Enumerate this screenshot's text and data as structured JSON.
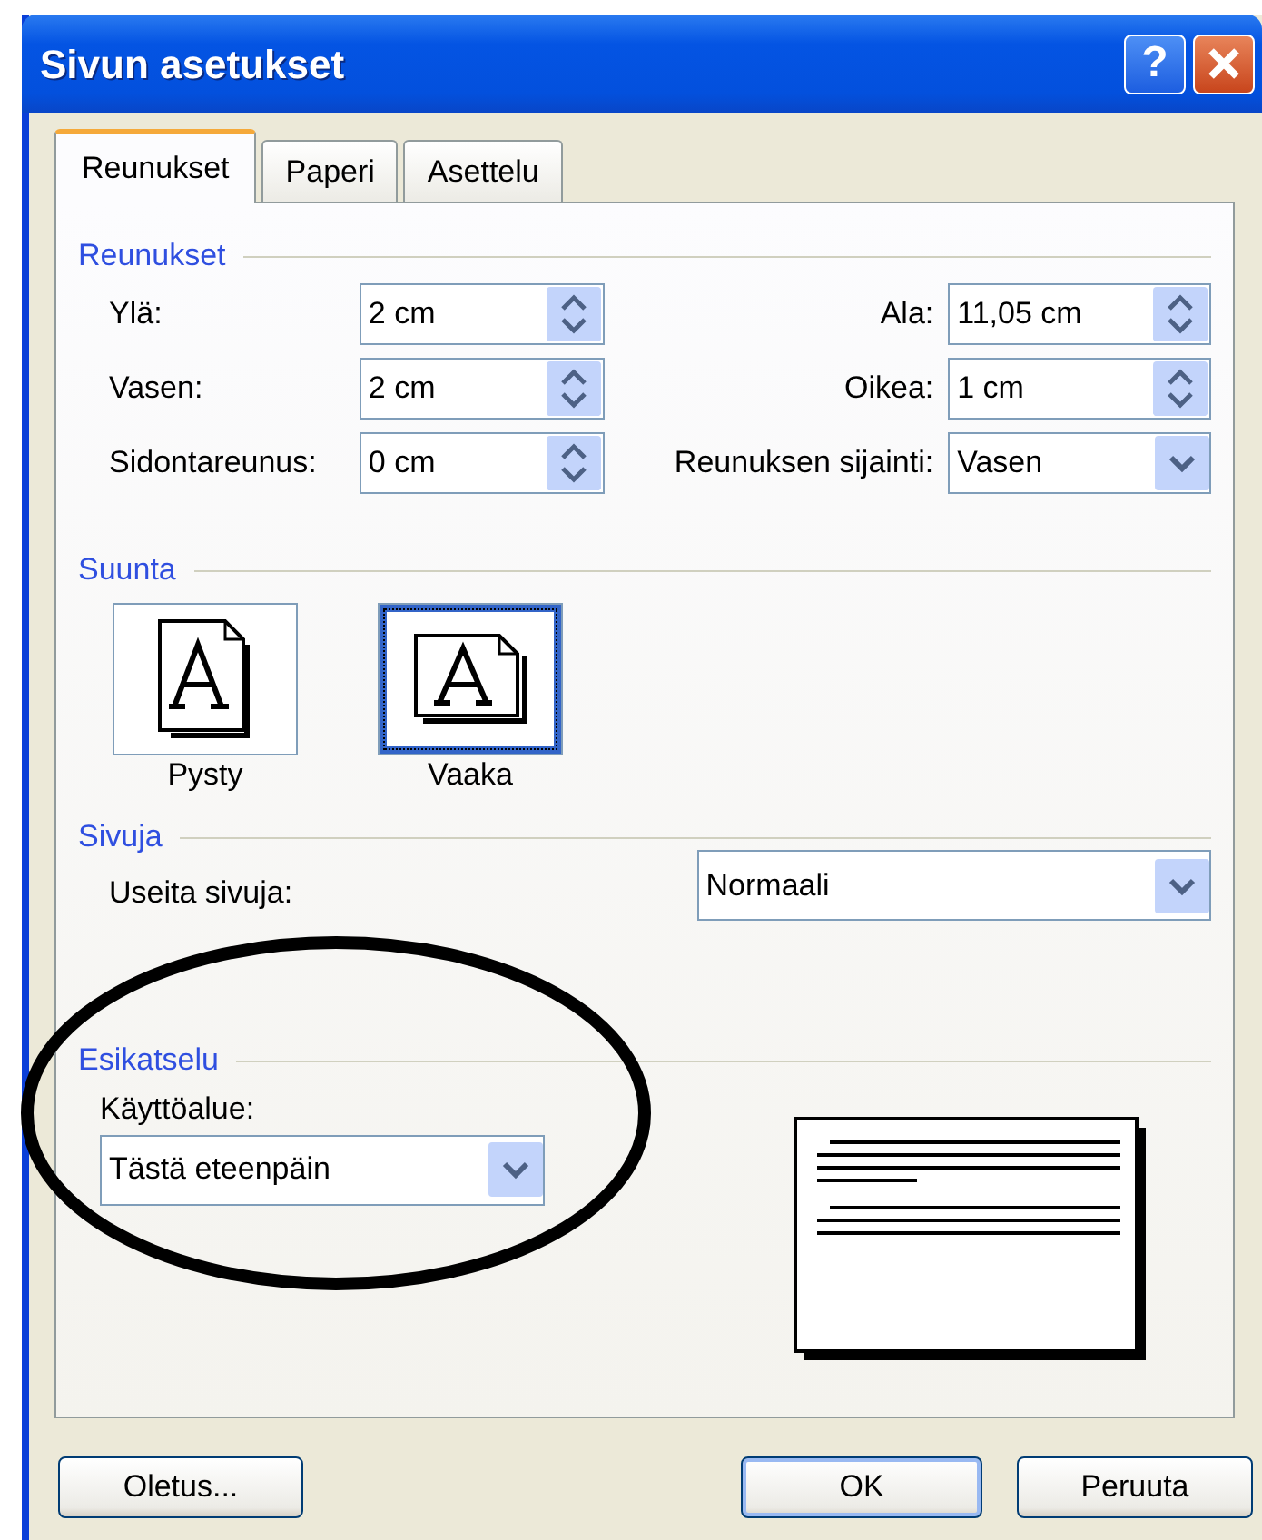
{
  "window": {
    "title": "Sivun asetukset"
  },
  "title_buttons": [
    {
      "kind": "help",
      "label": "?"
    },
    {
      "kind": "close"
    }
  ],
  "tabs": [
    {
      "label": "Reunukset",
      "selected": true
    },
    {
      "label": "Paperi",
      "selected": false
    },
    {
      "label": "Asettelu",
      "selected": false
    }
  ],
  "margins": {
    "title": "Reunukset",
    "rows": [
      {
        "left": {
          "label": "Ylä:",
          "value": "2 cm",
          "kind": "spin"
        },
        "right": {
          "label": "Ala:",
          "value": "11,05 cm",
          "kind": "spin"
        }
      },
      {
        "left": {
          "label": "Vasen:",
          "value": "2 cm",
          "kind": "spin"
        },
        "right": {
          "label": "Oikea:",
          "value": "1 cm",
          "kind": "spin"
        }
      },
      {
        "left": {
          "label": "Sidontareunus:",
          "value": "0 cm",
          "kind": "spin"
        },
        "right": {
          "label": "Reunuksen sijainti:",
          "value": "Vasen",
          "kind": "select"
        }
      }
    ]
  },
  "orientation": {
    "title": "Suunta",
    "options": [
      {
        "label": "Pysty",
        "kind": "portrait",
        "selected": false
      },
      {
        "label": "Vaaka",
        "kind": "landscape",
        "selected": true
      }
    ]
  },
  "pages": {
    "title": "Sivuja",
    "label": "Useita sivuja:",
    "value": "Normaali"
  },
  "preview": {
    "title": "Esikatselu",
    "apply_label": "Käyttöalue:",
    "apply_value": "Tästä eteenpäin"
  },
  "buttons": [
    {
      "label": "Oletus...",
      "default": false
    },
    {
      "label": "OK",
      "default": true
    },
    {
      "label": "Peruuta",
      "default": false
    }
  ],
  "annotations": [
    {
      "kind": "ellipse"
    }
  ]
}
